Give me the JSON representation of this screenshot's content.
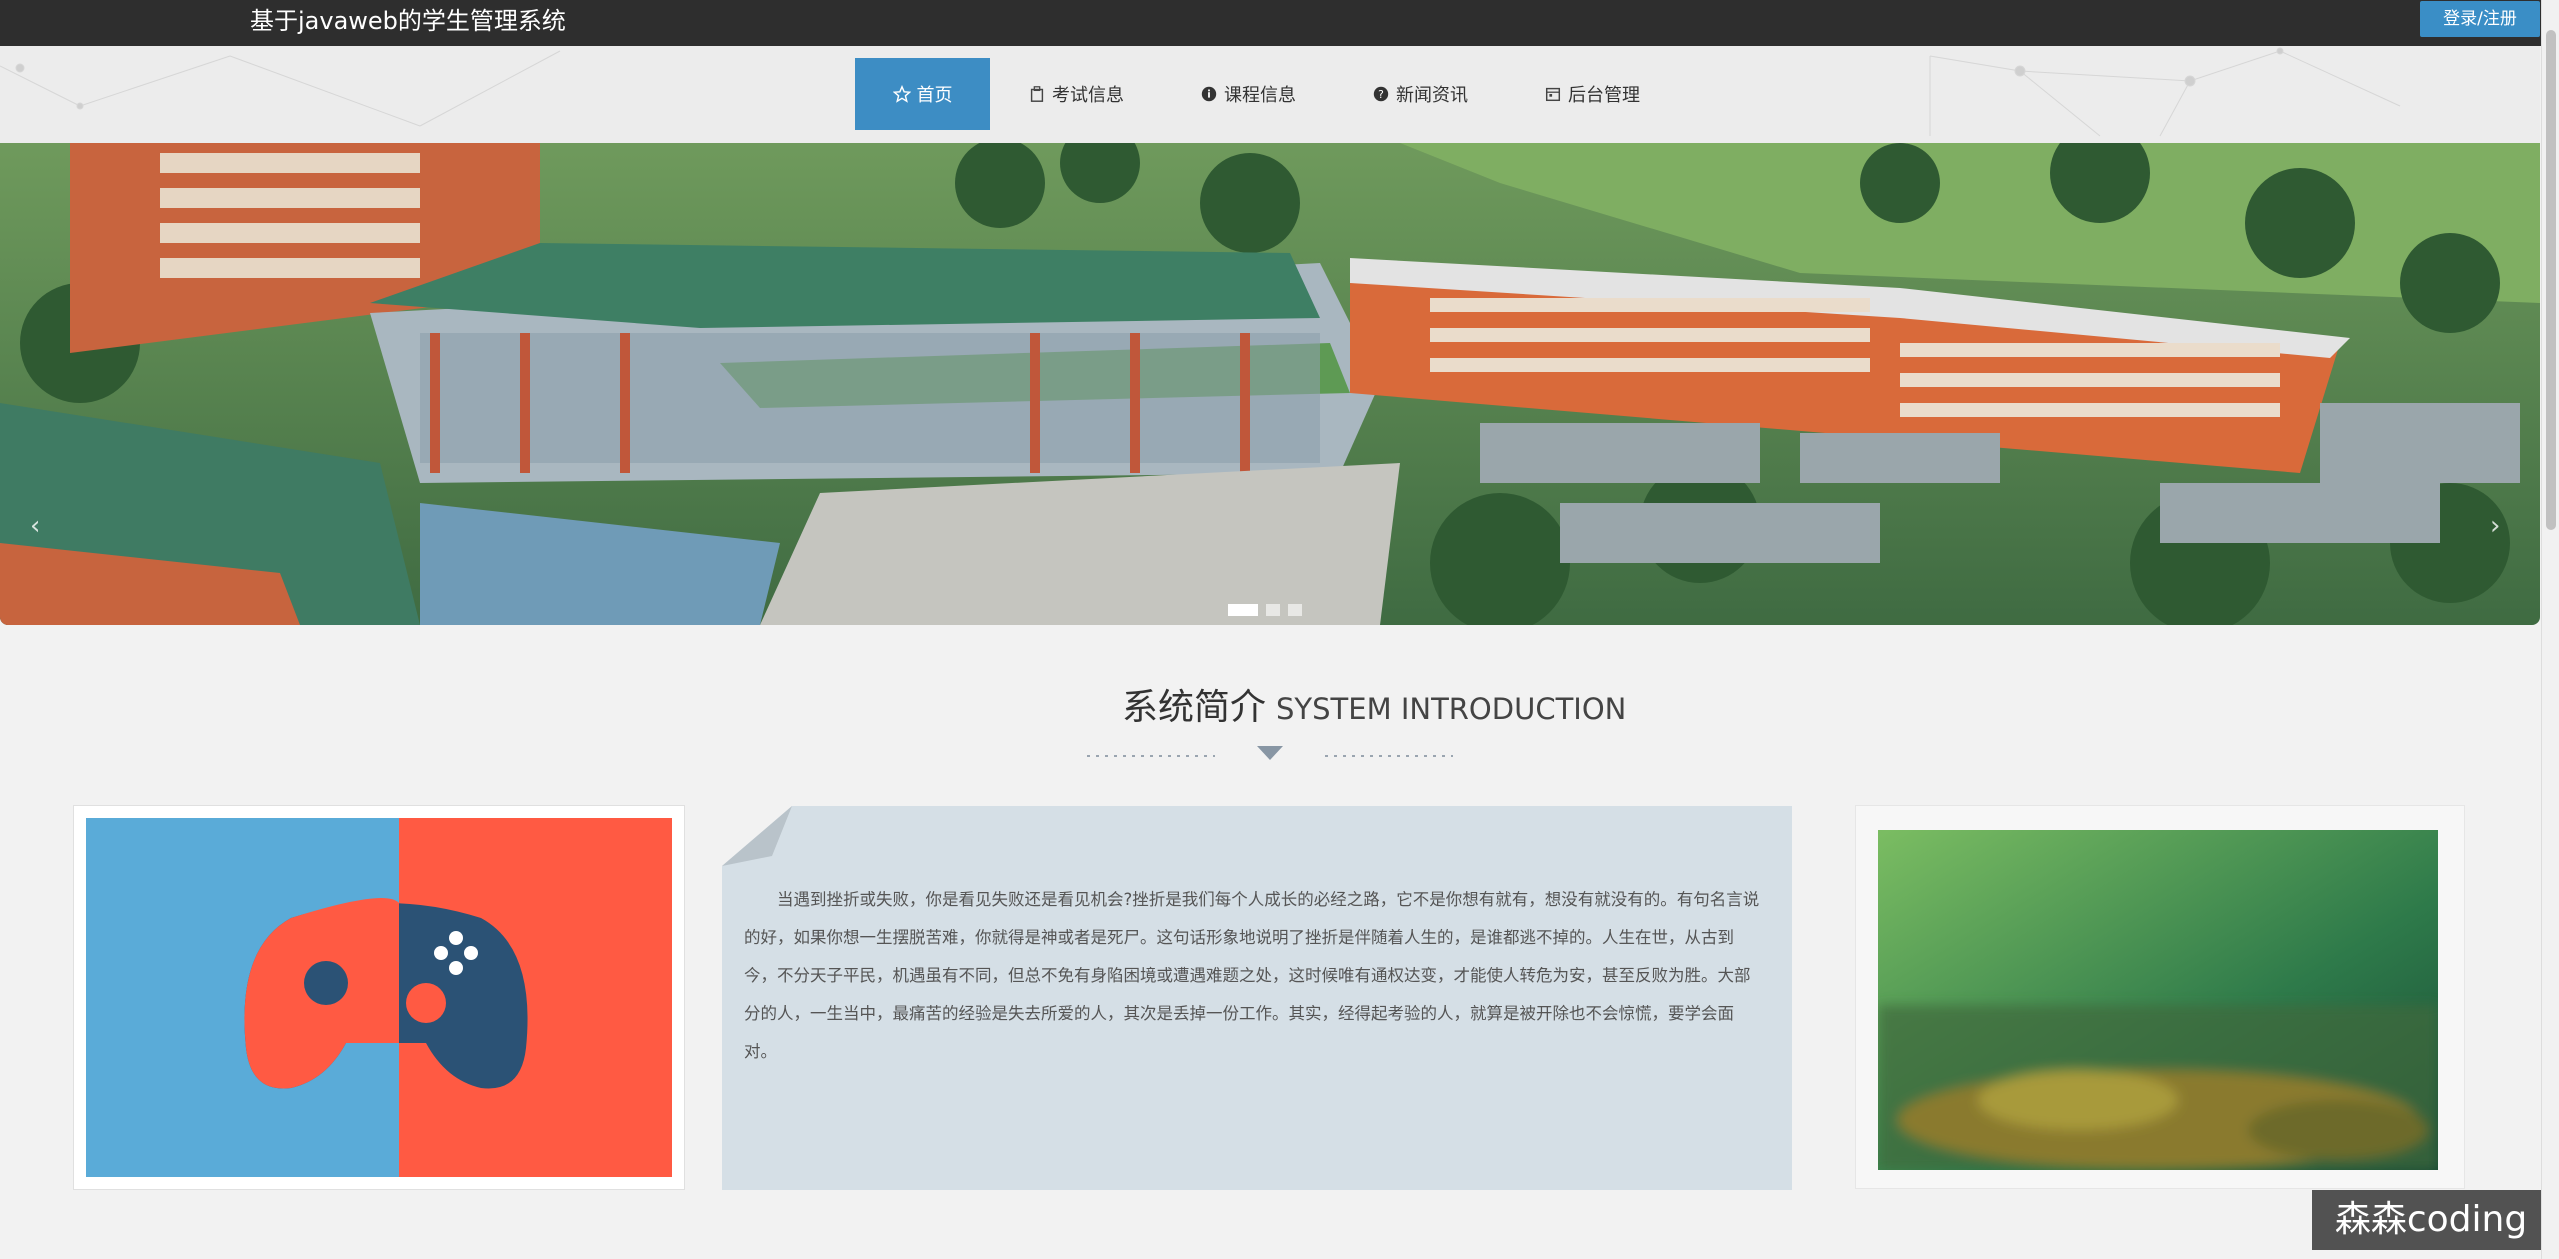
{
  "header": {
    "site_title": "基于javaweb的学生管理系统",
    "login_label": "登录/注册"
  },
  "nav": {
    "items": [
      {
        "label": "首页",
        "icon": "star-icon",
        "active": true
      },
      {
        "label": "考试信息",
        "icon": "clipboard-icon",
        "active": false
      },
      {
        "label": "课程信息",
        "icon": "info-circle-icon",
        "active": false
      },
      {
        "label": "新闻资讯",
        "icon": "question-circle-icon",
        "active": false
      },
      {
        "label": "后台管理",
        "icon": "calendar-icon",
        "active": false
      }
    ]
  },
  "banner": {
    "prev_arrow": "‹",
    "next_arrow": "›",
    "slides": 3,
    "active_slide": 1
  },
  "intro": {
    "title_cn": "系统简介",
    "title_en": "SYSTEM INTRODUCTION",
    "text": "当遇到挫折或失败，你是看见失败还是看见机会?挫折是我们每个人成长的必经之路，它不是你想有就有，想没有就没有的。有句名言说的好，如果你想一生摆脱苦难，你就得是神或者是死尸。这句话形象地说明了挫折是伴随着人生的，是谁都逃不掉的。人生在世，从古到今，不分天子平民，机遇虽有不同，但总不免有身陷困境或遭遇难题之处，这时候唯有通权达变，才能使人转危为安，甚至反败为胜。大部分的人，一生当中，最痛苦的经验是失去所爱的人，其次是丢掉一份工作。其实，经得起考验的人，就算是被开除也不会惊慌，要学会面对。"
  },
  "watermark": "森森coding",
  "colors": {
    "topbar": "#2e2e2e",
    "accent": "#3d8dc4",
    "card_blue": "#5aabd8",
    "card_red": "#ff5a43",
    "text_card_bg": "#d5dfe6"
  }
}
